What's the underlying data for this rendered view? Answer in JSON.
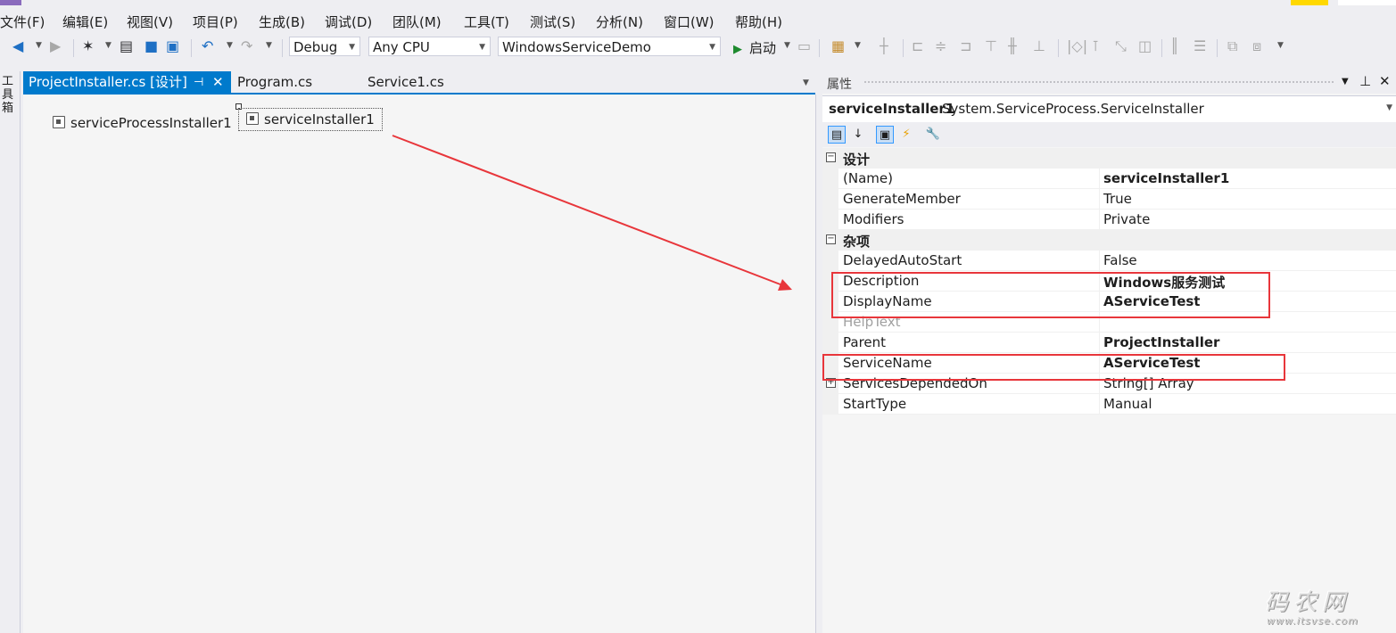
{
  "menu": [
    "文件(F)",
    "编辑(E)",
    "视图(V)",
    "项目(P)",
    "生成(B)",
    "调试(D)",
    "团队(M)",
    "工具(T)",
    "测试(S)",
    "分析(N)",
    "窗口(W)",
    "帮助(H)"
  ],
  "toolbar": {
    "config": "Debug",
    "platform": "Any CPU",
    "startup_project": "WindowsServiceDemo",
    "start_label": "启动"
  },
  "toolbox_label": "工具箱",
  "tabs": [
    {
      "label": "ProjectInstaller.cs [设计]",
      "active": true
    },
    {
      "label": "Program.cs",
      "active": false
    },
    {
      "label": "Service1.cs",
      "active": false
    }
  ],
  "designer": {
    "components": [
      "serviceProcessInstaller1",
      "serviceInstaller1"
    ]
  },
  "properties": {
    "title": "属性",
    "object_name": "serviceInstaller1",
    "object_type": "System.ServiceProcess.ServiceInstaller",
    "categories": [
      {
        "name": "设计",
        "rows": [
          {
            "name": "(Name)",
            "value": "serviceInstaller1",
            "bold": true
          },
          {
            "name": "GenerateMember",
            "value": "True",
            "bold": false
          },
          {
            "name": "Modifiers",
            "value": "Private",
            "bold": false
          }
        ]
      },
      {
        "name": "杂项",
        "rows": [
          {
            "name": "DelayedAutoStart",
            "value": "False",
            "bold": false
          },
          {
            "name": "Description",
            "value": "Windows服务测试",
            "bold": true
          },
          {
            "name": "DisplayName",
            "value": "AServiceTest",
            "bold": true
          },
          {
            "name": "HelpText",
            "value": "",
            "bold": false,
            "dim": true
          },
          {
            "name": "Parent",
            "value": "ProjectInstaller",
            "bold": true
          },
          {
            "name": "ServiceName",
            "value": "AServiceTest",
            "bold": true
          },
          {
            "name": "ServicesDependedOn",
            "value": "String[] Array",
            "bold": false,
            "expandable": true
          },
          {
            "name": "StartType",
            "value": "Manual",
            "bold": false
          }
        ]
      }
    ]
  },
  "colors": {
    "accent": "#007acc",
    "annotation_red": "#e8363b",
    "run_green": "#1e8a2e"
  },
  "watermark": {
    "text": "码农网",
    "url": "www.itsvse.com"
  }
}
